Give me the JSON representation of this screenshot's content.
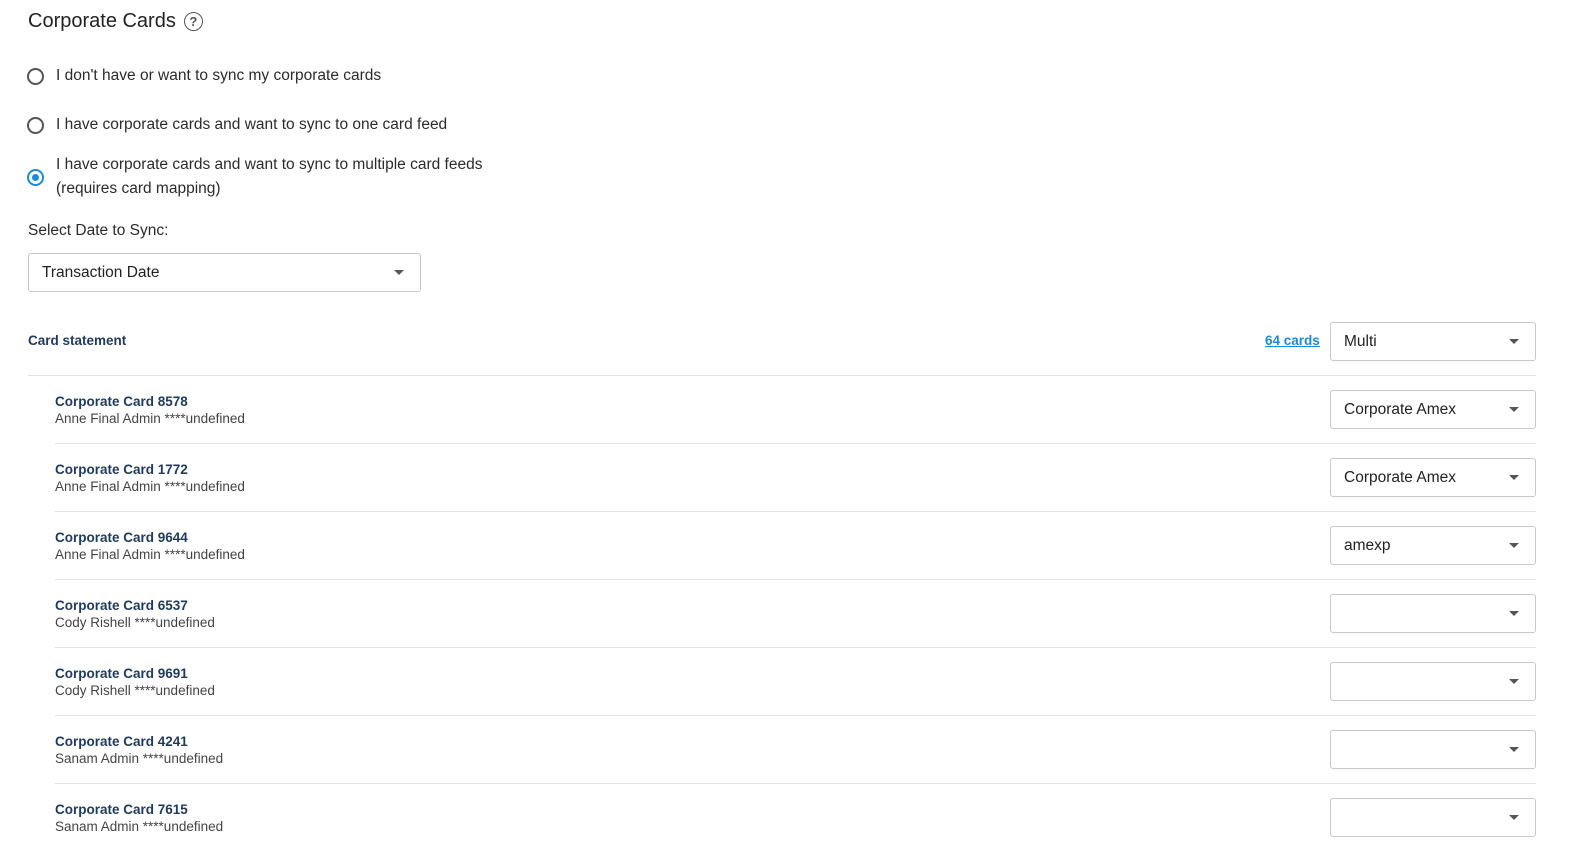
{
  "section": {
    "title": "Corporate Cards",
    "options": [
      {
        "label": "I don't have or want to sync my corporate cards",
        "checked": false
      },
      {
        "label": "I have corporate cards and want to sync to one card feed",
        "checked": false
      },
      {
        "label": "I have corporate cards and want to sync to multiple card feeds",
        "label_line2": "(requires card mapping)",
        "checked": true
      }
    ]
  },
  "date_sync": {
    "label": "Select Date to Sync:",
    "value": "Transaction Date"
  },
  "card_statement": {
    "label": "Card statement",
    "count_link": "64 cards",
    "feed_value": "Multi"
  },
  "cards": [
    {
      "name": "Corporate Card 8578",
      "owner": "Anne Final Admin ****undefined",
      "feed": "Corporate Amex"
    },
    {
      "name": "Corporate Card 1772",
      "owner": "Anne Final Admin ****undefined",
      "feed": "Corporate Amex"
    },
    {
      "name": "Corporate Card 9644",
      "owner": "Anne Final Admin ****undefined",
      "feed": "amexp"
    },
    {
      "name": "Corporate Card 6537",
      "owner": "Cody Rishell ****undefined",
      "feed": ""
    },
    {
      "name": "Corporate Card 9691",
      "owner": "Cody Rishell ****undefined",
      "feed": ""
    },
    {
      "name": "Corporate Card 4241",
      "owner": "Sanam Admin ****undefined",
      "feed": ""
    },
    {
      "name": "Corporate Card 7615",
      "owner": "Sanam Admin ****undefined",
      "feed": ""
    }
  ],
  "colors": {
    "accent": "#1d8ad6",
    "heading": "#1f3a5c"
  }
}
